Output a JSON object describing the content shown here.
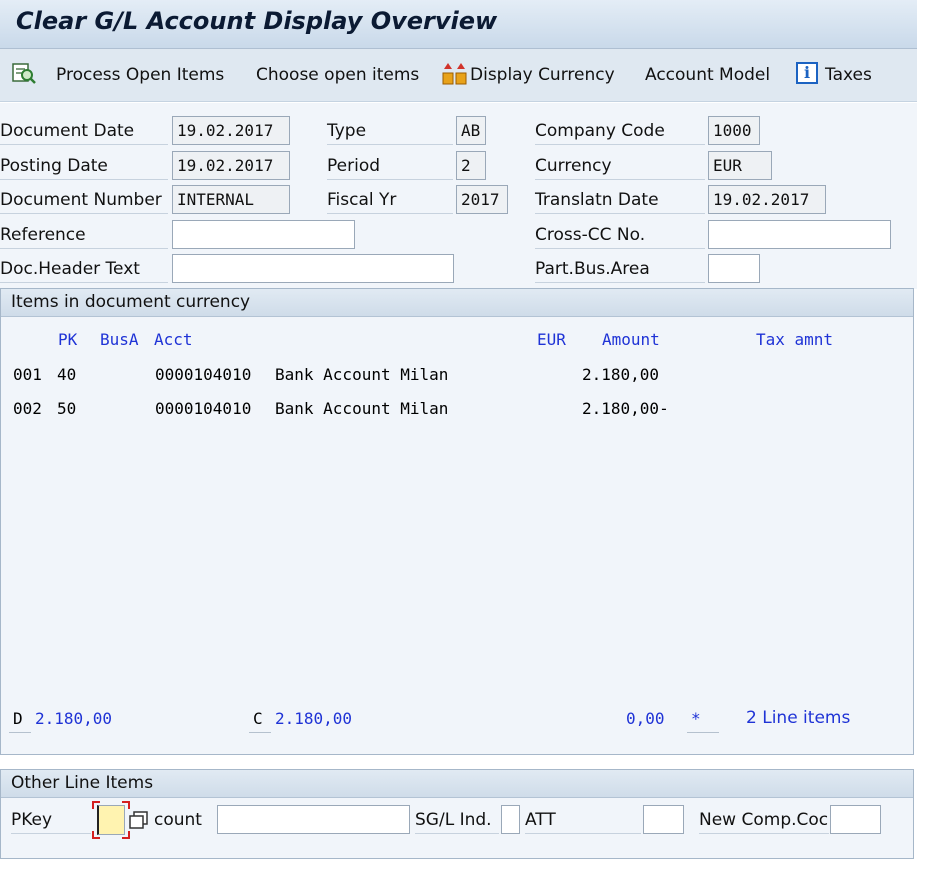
{
  "window": {
    "title": "Clear G/L Account Display Overview"
  },
  "toolbar": {
    "process_open_items": "Process Open Items",
    "choose_open_items": "Choose open items",
    "display_currency": "Display Currency",
    "account_model": "Account Model",
    "taxes": "Taxes",
    "info_glyph": "i"
  },
  "header": {
    "document_date": {
      "label": "Document Date",
      "value": "19.02.2017"
    },
    "posting_date": {
      "label": "Posting Date",
      "value": "19.02.2017"
    },
    "document_number": {
      "label": "Document Number",
      "value": "INTERNAL"
    },
    "reference": {
      "label": "Reference",
      "value": ""
    },
    "doc_header_text": {
      "label": "Doc.Header Text",
      "value": ""
    },
    "type": {
      "label": "Type",
      "value": "AB"
    },
    "period": {
      "label": "Period",
      "value": "2"
    },
    "fiscal_yr": {
      "label": "Fiscal Yr",
      "value": "2017"
    },
    "company_code": {
      "label": "Company Code",
      "value": "1000"
    },
    "currency": {
      "label": "Currency",
      "value": "EUR"
    },
    "translatn_date": {
      "label": "Translatn Date",
      "value": "19.02.2017"
    },
    "cross_cc_no": {
      "label": "Cross-CC No.",
      "value": ""
    },
    "part_bus_area": {
      "label": "Part.Bus.Area",
      "value": ""
    }
  },
  "items": {
    "section_title": "Items in document currency",
    "columns": {
      "pk": "PK",
      "busa": "BusA",
      "acct": "Acct",
      "currency": "EUR",
      "amount": "Amount",
      "tax_amnt": "Tax amnt"
    },
    "rows": [
      {
        "line": "001",
        "pk": "40",
        "acct": "0000104010",
        "name": "Bank Account Milan",
        "amount": "2.180,00"
      },
      {
        "line": "002",
        "pk": "50",
        "acct": "0000104010",
        "name": "Bank Account Milan",
        "amount": "2.180,00-"
      }
    ],
    "totals": {
      "debit_label": "D",
      "debit_value": "2.180,00",
      "credit_label": "C",
      "credit_value": "2.180,00",
      "balance": "0,00",
      "balance_marker": "*",
      "line_items": "2 Line items"
    }
  },
  "other_items": {
    "section_title": "Other Line Items",
    "pkey_label": "PKey",
    "pkey_value": "",
    "account_label": "count",
    "account_value": "",
    "sgl_ind_label": "SG/L Ind.",
    "sgl_ind_value": "",
    "att_label": "ATT",
    "att_value": "",
    "new_comp_code_label": "New Comp.Coc",
    "new_comp_code_value": ""
  }
}
